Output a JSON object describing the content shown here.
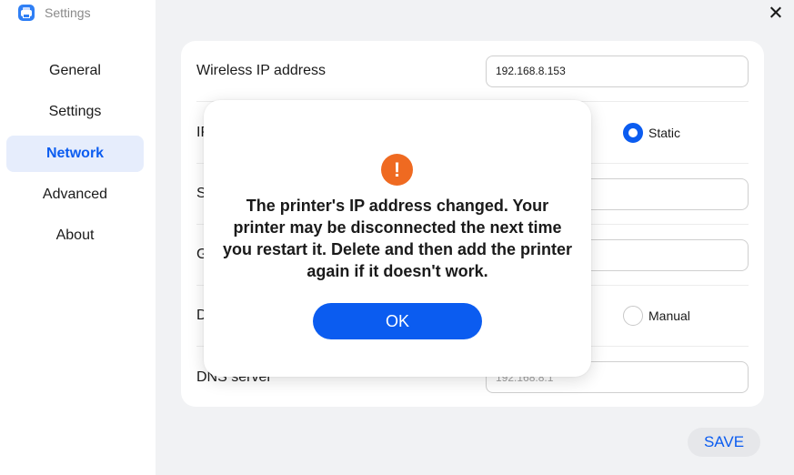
{
  "window": {
    "title": "Settings",
    "app_icon": "printer-icon",
    "close_icon": "close-icon"
  },
  "sidebar": {
    "items": [
      {
        "label": "General",
        "active": false
      },
      {
        "label": "Settings",
        "active": false
      },
      {
        "label": "Network",
        "active": true
      },
      {
        "label": "Advanced",
        "active": false
      },
      {
        "label": "About",
        "active": false
      }
    ]
  },
  "network": {
    "wireless_ip": {
      "label": "Wireless IP address",
      "value": "192.168.8.153"
    },
    "ip_mode": {
      "label": "IP",
      "selected_option": "Static"
    },
    "subnet": {
      "label": "S",
      "value": ""
    },
    "gateway": {
      "label": "G",
      "value": ""
    },
    "dns_mode": {
      "label": "D",
      "visible_option": "Manual",
      "visible_option_checked": false
    },
    "dns_server": {
      "label": "DNS server",
      "placeholder": "192.168.8.1"
    }
  },
  "footer": {
    "save_label": "SAVE"
  },
  "dialog": {
    "icon": "warning-icon",
    "icon_glyph": "!",
    "icon_color": "#ef6a21",
    "message": "The printer's IP address changed. Your printer may be disconnected the next time you restart it. Delete and then add the printer again if it doesn't work.",
    "ok_label": "OK"
  },
  "colors": {
    "accent": "#0b5cf0",
    "active_nav_bg": "#e6edfc",
    "background": "#f1f2f4"
  }
}
